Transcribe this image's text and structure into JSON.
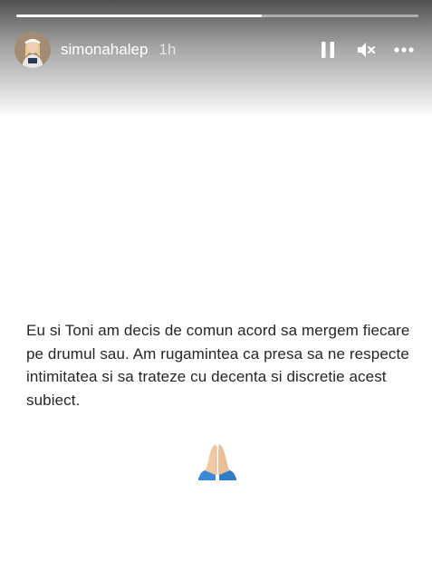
{
  "story": {
    "progress": 0.61,
    "username": "simonahalep",
    "time_ago": "1h"
  },
  "controls": {
    "pause_icon": "pause-icon",
    "mute_icon": "speaker-muted-icon",
    "more_icon": "more-horizontal-icon"
  },
  "message": {
    "text": "Eu si Toni am decis de comun acord sa mergem fiecare pe drumul sau. Am rugamintea ca presa sa ne respecte intimitatea si sa trateze cu decenta si discretie acest subiect."
  },
  "emoji": {
    "name": "folded-hands-icon"
  }
}
